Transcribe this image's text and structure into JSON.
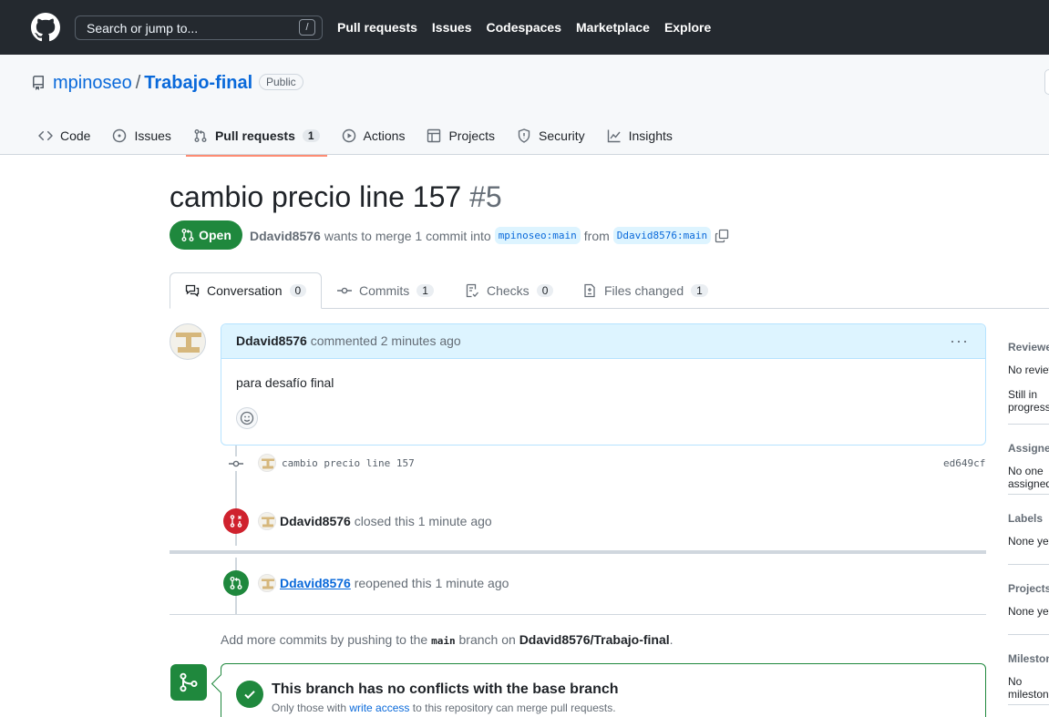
{
  "header": {
    "search_placeholder": "Search or jump to...",
    "search_shortcut": "/",
    "nav": [
      "Pull requests",
      "Issues",
      "Codespaces",
      "Marketplace",
      "Explore"
    ]
  },
  "repo": {
    "owner": "mpinoseo",
    "separator": "/",
    "name": "Trabajo-final",
    "visibility": "Public"
  },
  "repo_tabs": [
    {
      "label": "Code",
      "icon": "code-icon"
    },
    {
      "label": "Issues",
      "icon": "issue-icon"
    },
    {
      "label": "Pull requests",
      "icon": "pull-request-icon",
      "count": "1",
      "active": true
    },
    {
      "label": "Actions",
      "icon": "play-icon"
    },
    {
      "label": "Projects",
      "icon": "table-icon"
    },
    {
      "label": "Security",
      "icon": "shield-icon"
    },
    {
      "label": "Insights",
      "icon": "graph-icon"
    }
  ],
  "pr": {
    "title": "cambio precio line 157",
    "number": "#5",
    "state": "Open",
    "author": "Ddavid8576",
    "merge_text": "wants to merge 1 commit into",
    "base_branch": "mpinoseo:main",
    "from_text": "from",
    "head_branch": "Ddavid8576:main"
  },
  "pr_tabs": [
    {
      "label": "Conversation",
      "count": "0"
    },
    {
      "label": "Commits",
      "count": "1"
    },
    {
      "label": "Checks",
      "count": "0"
    },
    {
      "label": "Files changed",
      "count": "1"
    }
  ],
  "comment": {
    "author": "Ddavid8576",
    "action": "commented 2 minutes ago",
    "menu": "···",
    "body": "para desafío final"
  },
  "commit": {
    "message": "cambio precio line 157",
    "sha": "ed649cf"
  },
  "events": {
    "closed_author": "Ddavid8576",
    "closed_text": "closed this 1 minute ago",
    "reopened_author": "Ddavid8576",
    "reopened_text": "reopened this 1 minute ago"
  },
  "hint": {
    "prefix": "Add more commits by pushing to the",
    "branch": "main",
    "middle": "branch on",
    "repo": "Ddavid8576/Trabajo-final",
    "suffix": "."
  },
  "merge": {
    "title": "This branch has no conflicts with the base branch",
    "sub_prefix": "Only those with",
    "sub_link": "write access",
    "sub_suffix": "to this repository can merge pull requests."
  },
  "sidebar": [
    {
      "heading": "Reviewers",
      "value": "No reviews",
      "value2": "Still in progress?"
    },
    {
      "heading": "Assignees",
      "value": "No one assigned"
    },
    {
      "heading": "Labels",
      "value": "None yet"
    },
    {
      "heading": "Projects",
      "value": "None yet"
    },
    {
      "heading": "Milestone",
      "value": "No milestone"
    }
  ],
  "colors": {
    "header_bg": "#24292f",
    "open_green": "#1f883d",
    "closed_red": "#cf222e",
    "link_blue": "#0969da",
    "active_tab_underline": "#fd8c73"
  }
}
